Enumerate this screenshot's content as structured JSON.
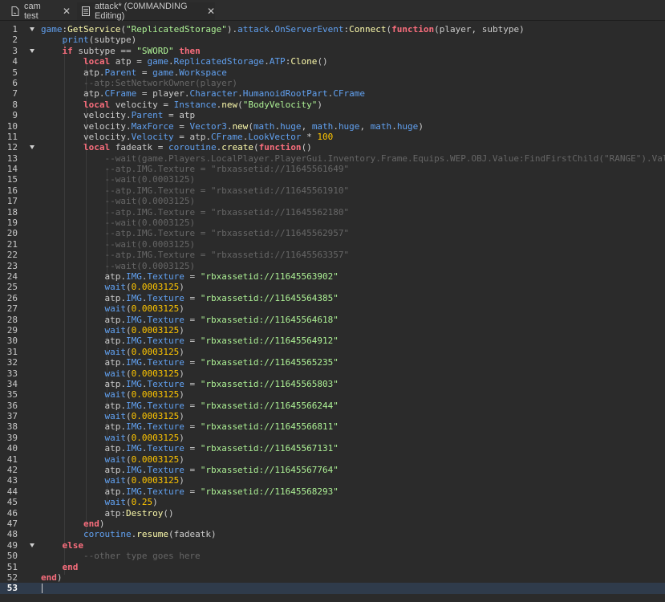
{
  "tabs": [
    {
      "label": "cam test",
      "icon": "script-file-icon",
      "active": false
    },
    {
      "label": "attack* (C0MMANDING Editing)",
      "icon": "document-icon",
      "active": true
    }
  ],
  "editor": {
    "current_line": 53,
    "lines": [
      {
        "n": "1",
        "fold": true,
        "html": "<span class=\"p\">game</span>:<span class=\"f\">GetService</span>(<span class=\"s\">\"ReplicatedStorage\"</span>).<span class=\"p\">attack</span>.<span class=\"p\">OnServerEvent</span>:<span class=\"f\">Connect</span>(<span class=\"k\">function</span>(player, subtype)"
      },
      {
        "n": "2",
        "fold": false,
        "html": "    <span class=\"p\">print</span>(subtype)"
      },
      {
        "n": "3",
        "fold": true,
        "html": "    <span class=\"k\">if</span> subtype == <span class=\"s\">\"SWORD\"</span> <span class=\"k\">then</span>"
      },
      {
        "n": "4",
        "fold": false,
        "html": "        <span class=\"k\">local</span> atp = <span class=\"p\">game</span>.<span class=\"p\">ReplicatedStorage</span>.<span class=\"p\">ATP</span>:<span class=\"f\">Clone</span>()"
      },
      {
        "n": "5",
        "fold": false,
        "html": "        atp.<span class=\"p\">Parent</span> = <span class=\"p\">game</span>.<span class=\"p\">Workspace</span>"
      },
      {
        "n": "6",
        "fold": false,
        "html": "        <span class=\"c\">--atp:SetNetworkOwner(player)</span>"
      },
      {
        "n": "7",
        "fold": false,
        "html": "        atp.<span class=\"p\">CFrame</span> = player.<span class=\"p\">Character</span>.<span class=\"p\">HumanoidRootPart</span>.<span class=\"p\">CFrame</span>"
      },
      {
        "n": "8",
        "fold": false,
        "html": "        <span class=\"k\">local</span> velocity = <span class=\"p\">Instance</span>.<span class=\"f\">new</span>(<span class=\"s\">\"BodyVelocity\"</span>)"
      },
      {
        "n": "9",
        "fold": false,
        "html": "        velocity.<span class=\"p\">Parent</span> = atp"
      },
      {
        "n": "10",
        "fold": false,
        "html": "        velocity.<span class=\"p\">MaxForce</span> = <span class=\"p\">Vector3</span>.<span class=\"f\">new</span>(<span class=\"p\">math</span>.<span class=\"p\">huge</span>, <span class=\"p\">math</span>.<span class=\"p\">huge</span>, <span class=\"p\">math</span>.<span class=\"p\">huge</span>)"
      },
      {
        "n": "11",
        "fold": false,
        "html": "        velocity.<span class=\"p\">Velocity</span> = atp.<span class=\"p\">CFrame</span>.<span class=\"p\">LookVector</span> * <span class=\"n\">100</span>"
      },
      {
        "n": "12",
        "fold": true,
        "html": "        <span class=\"k\">local</span> fadeatk = <span class=\"p\">coroutine</span>.<span class=\"f\">create</span>(<span class=\"k\">function</span>()"
      },
      {
        "n": "13",
        "fold": false,
        "html": "            <span class=\"c\">--wait(game.Players.LocalPlayer.PlayerGui.Inventory.Frame.Equips.WEP.OBJ.Value:FindFirstChild(\"RANGE\").Value)</span>"
      },
      {
        "n": "14",
        "fold": false,
        "html": "            <span class=\"c\">--atp.IMG.Texture = \"rbxassetid://11645561649\"</span>"
      },
      {
        "n": "15",
        "fold": false,
        "html": "            <span class=\"c\">--wait(0.0003125)</span>"
      },
      {
        "n": "16",
        "fold": false,
        "html": "            <span class=\"c\">--atp.IMG.Texture = \"rbxassetid://11645561910\"</span>"
      },
      {
        "n": "17",
        "fold": false,
        "html": "            <span class=\"c\">--wait(0.0003125)</span>"
      },
      {
        "n": "18",
        "fold": false,
        "html": "            <span class=\"c\">--atp.IMG.Texture = \"rbxassetid://11645562180\"</span>"
      },
      {
        "n": "19",
        "fold": false,
        "html": "            <span class=\"c\">--wait(0.0003125)</span>"
      },
      {
        "n": "20",
        "fold": false,
        "html": "            <span class=\"c\">--atp.IMG.Texture = \"rbxassetid://11645562957\"</span>"
      },
      {
        "n": "21",
        "fold": false,
        "html": "            <span class=\"c\">--wait(0.0003125)</span>"
      },
      {
        "n": "22",
        "fold": false,
        "html": "            <span class=\"c\">--atp.IMG.Texture = \"rbxassetid://11645563357\"</span>"
      },
      {
        "n": "23",
        "fold": false,
        "html": "            <span class=\"c\">--wait(0.0003125)</span>"
      },
      {
        "n": "24",
        "fold": false,
        "html": "            atp.<span class=\"p\">IMG</span>.<span class=\"p\">Texture</span> = <span class=\"s\">\"rbxassetid://11645563902\"</span>"
      },
      {
        "n": "25",
        "fold": false,
        "html": "            <span class=\"p\">wait</span>(<span class=\"n\">0.0003125</span>)"
      },
      {
        "n": "26",
        "fold": false,
        "html": "            atp.<span class=\"p\">IMG</span>.<span class=\"p\">Texture</span> = <span class=\"s\">\"rbxassetid://11645564385\"</span>"
      },
      {
        "n": "27",
        "fold": false,
        "html": "            <span class=\"p\">wait</span>(<span class=\"n\">0.0003125</span>)"
      },
      {
        "n": "28",
        "fold": false,
        "html": "            atp.<span class=\"p\">IMG</span>.<span class=\"p\">Texture</span> = <span class=\"s\">\"rbxassetid://11645564618\"</span>"
      },
      {
        "n": "29",
        "fold": false,
        "html": "            <span class=\"p\">wait</span>(<span class=\"n\">0.0003125</span>)"
      },
      {
        "n": "30",
        "fold": false,
        "html": "            atp.<span class=\"p\">IMG</span>.<span class=\"p\">Texture</span> = <span class=\"s\">\"rbxassetid://11645564912\"</span>"
      },
      {
        "n": "31",
        "fold": false,
        "html": "            <span class=\"p\">wait</span>(<span class=\"n\">0.0003125</span>)"
      },
      {
        "n": "32",
        "fold": false,
        "html": "            atp.<span class=\"p\">IMG</span>.<span class=\"p\">Texture</span> = <span class=\"s\">\"rbxassetid://11645565235\"</span>"
      },
      {
        "n": "33",
        "fold": false,
        "html": "            <span class=\"p\">wait</span>(<span class=\"n\">0.0003125</span>)"
      },
      {
        "n": "34",
        "fold": false,
        "html": "            atp.<span class=\"p\">IMG</span>.<span class=\"p\">Texture</span> = <span class=\"s\">\"rbxassetid://11645565803\"</span>"
      },
      {
        "n": "35",
        "fold": false,
        "html": "            <span class=\"p\">wait</span>(<span class=\"n\">0.0003125</span>)"
      },
      {
        "n": "36",
        "fold": false,
        "html": "            atp.<span class=\"p\">IMG</span>.<span class=\"p\">Texture</span> = <span class=\"s\">\"rbxassetid://11645566244\"</span>"
      },
      {
        "n": "37",
        "fold": false,
        "html": "            <span class=\"p\">wait</span>(<span class=\"n\">0.0003125</span>)"
      },
      {
        "n": "38",
        "fold": false,
        "html": "            atp.<span class=\"p\">IMG</span>.<span class=\"p\">Texture</span> = <span class=\"s\">\"rbxassetid://11645566811\"</span>"
      },
      {
        "n": "39",
        "fold": false,
        "html": "            <span class=\"p\">wait</span>(<span class=\"n\">0.0003125</span>)"
      },
      {
        "n": "40",
        "fold": false,
        "html": "            atp.<span class=\"p\">IMG</span>.<span class=\"p\">Texture</span> = <span class=\"s\">\"rbxassetid://11645567131\"</span>"
      },
      {
        "n": "41",
        "fold": false,
        "html": "            <span class=\"p\">wait</span>(<span class=\"n\">0.0003125</span>)"
      },
      {
        "n": "42",
        "fold": false,
        "html": "            atp.<span class=\"p\">IMG</span>.<span class=\"p\">Texture</span> = <span class=\"s\">\"rbxassetid://11645567764\"</span>"
      },
      {
        "n": "43",
        "fold": false,
        "html": "            <span class=\"p\">wait</span>(<span class=\"n\">0.0003125</span>)"
      },
      {
        "n": "44",
        "fold": false,
        "html": "            atp.<span class=\"p\">IMG</span>.<span class=\"p\">Texture</span> = <span class=\"s\">\"rbxassetid://11645568293\"</span>"
      },
      {
        "n": "45",
        "fold": false,
        "html": "            <span class=\"p\">wait</span>(<span class=\"n\">0.25</span>)"
      },
      {
        "n": "46",
        "fold": false,
        "html": "            atp:<span class=\"f\">Destroy</span>()"
      },
      {
        "n": "47",
        "fold": false,
        "html": "        <span class=\"k\">end</span>)"
      },
      {
        "n": "48",
        "fold": false,
        "html": "        <span class=\"p\">coroutine</span>.<span class=\"f\">resume</span>(fadeatk)"
      },
      {
        "n": "49",
        "fold": true,
        "html": "    <span class=\"k\">else</span>"
      },
      {
        "n": "50",
        "fold": false,
        "html": "        <span class=\"c\">--other type goes here</span>"
      },
      {
        "n": "51",
        "fold": false,
        "html": "    <span class=\"k\">end</span>"
      },
      {
        "n": "52",
        "fold": false,
        "html": "<span class=\"k\">end</span>)"
      },
      {
        "n": "53",
        "fold": false,
        "html": ""
      }
    ]
  }
}
